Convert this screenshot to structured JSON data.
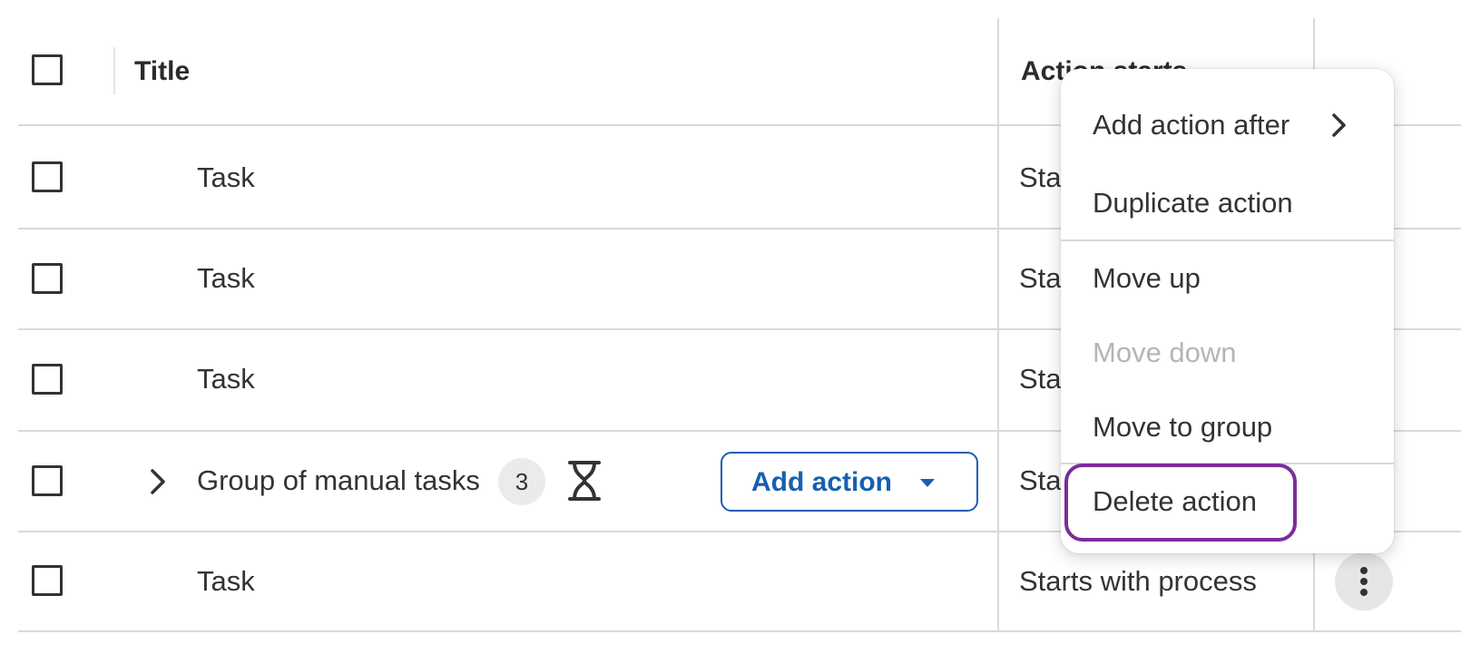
{
  "header": {
    "title_col": "Title",
    "action_starts_col": "Action starts"
  },
  "rows": [
    {
      "title": "Task",
      "starts": "Starts with process"
    },
    {
      "title": "Task",
      "starts": "Starts with process"
    },
    {
      "title": "Task",
      "starts": "Starts with process"
    },
    {
      "title": "Group of manual tasks",
      "count": "3",
      "starts": "Starts with process",
      "add_action_label": "Add action"
    },
    {
      "title": "Task",
      "starts": "Starts with process"
    }
  ],
  "menu": {
    "items": [
      {
        "label": "Add action after",
        "disabled": false
      },
      {
        "label": "Duplicate action",
        "disabled": false
      },
      {
        "label": "Move up",
        "disabled": false
      },
      {
        "label": "Move down",
        "disabled": true
      },
      {
        "label": "Move to group",
        "disabled": false
      },
      {
        "label": "Delete action",
        "disabled": false,
        "focused": true
      }
    ]
  },
  "colors": {
    "accent": "#1660b0",
    "focus": "#7b2d9b",
    "disabled_text": "#b5b5b5"
  },
  "icons": {
    "expand": "chevron-right-icon",
    "waiting": "hourglass-icon",
    "more": "kebab-menu-icon",
    "submenu": "chevron-right-icon"
  }
}
